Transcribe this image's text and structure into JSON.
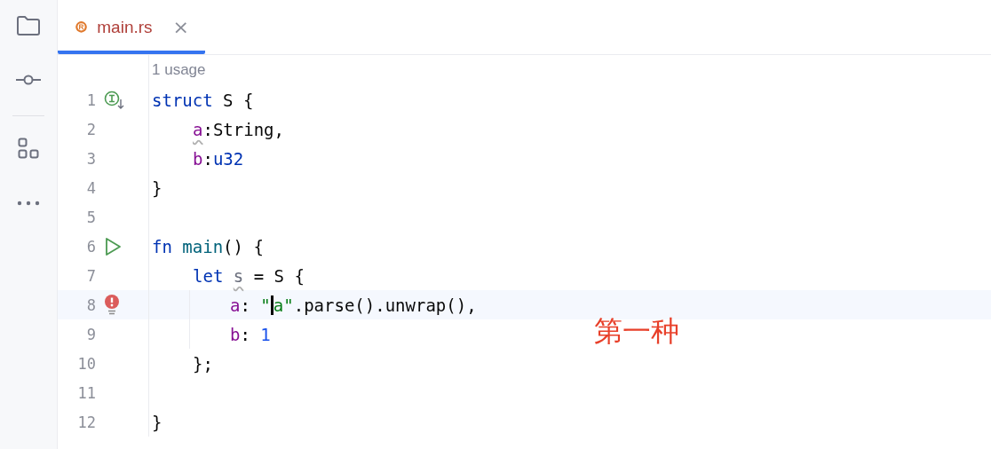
{
  "sidebar": {
    "items": [
      {
        "kind": "folder"
      },
      {
        "kind": "commit"
      },
      {
        "kind": "divider"
      },
      {
        "kind": "structure"
      },
      {
        "kind": "more"
      }
    ]
  },
  "tabs": [
    {
      "label": "main.rs",
      "selected": true,
      "close": "×"
    }
  ],
  "editor": {
    "usage_hint": "1 usage",
    "lines": [
      {
        "number": "1",
        "marker": {
          "kind": "implemented"
        },
        "tokens": [
          {
            "text": "struct",
            "kind": "keyword"
          },
          {
            "text": " S {",
            "kind": "plain"
          }
        ],
        "children": [
          {
            "number": "2",
            "tokens": [
              {
                "text": "a",
                "kind": "field",
                "warning": true
              },
              {
                "text": ":String,",
                "kind": "plain"
              }
            ]
          },
          {
            "number": "3",
            "tokens": [
              {
                "text": "b",
                "kind": "field"
              },
              {
                "text": ":",
                "kind": "plain"
              },
              {
                "text": "u32",
                "kind": "keyword"
              }
            ]
          }
        ]
      },
      {
        "number": "4",
        "tokens": [
          {
            "text": "}",
            "kind": "plain"
          }
        ]
      },
      {
        "number": "5"
      },
      {
        "number": "6",
        "marker": {
          "kind": "run"
        },
        "tokens": [
          {
            "text": "fn ",
            "kind": "keyword"
          },
          {
            "text": "main",
            "kind": "function"
          },
          {
            "text": "() {",
            "kind": "plain"
          }
        ],
        "children": [
          {
            "number": "7",
            "tokens": [
              {
                "text": "let ",
                "kind": "keyword"
              },
              {
                "text": "s",
                "kind": "variable",
                "warning": true
              },
              {
                "text": " = S {",
                "kind": "plain"
              }
            ],
            "children": [
              {
                "number": "8",
                "marker": {
                  "kind": "error"
                },
                "current": true,
                "tokens": [
                  {
                    "text": "a",
                    "kind": "field"
                  },
                  {
                    "text": ": ",
                    "kind": "plain"
                  },
                  {
                    "text": "\"",
                    "kind": "string"
                  },
                  {
                    "text": "a\"",
                    "kind": "string",
                    "caret": true
                  },
                  {
                    "text": ".parse().unwrap(),",
                    "kind": "plain"
                  }
                ]
              },
              {
                "number": "9",
                "tokens": [
                  {
                    "text": "b",
                    "kind": "field"
                  },
                  {
                    "text": ": ",
                    "kind": "plain"
                  },
                  {
                    "text": "1",
                    "kind": "number"
                  }
                ]
              }
            ]
          },
          {
            "number": "10",
            "tokens": [
              {
                "text": "};",
                "kind": "plain"
              }
            ]
          },
          {
            "number": "11"
          }
        ]
      },
      {
        "number": "12",
        "tokens": [
          {
            "text": "}",
            "kind": "plain"
          }
        ]
      }
    ]
  },
  "annotation": {
    "text": "第一种"
  }
}
